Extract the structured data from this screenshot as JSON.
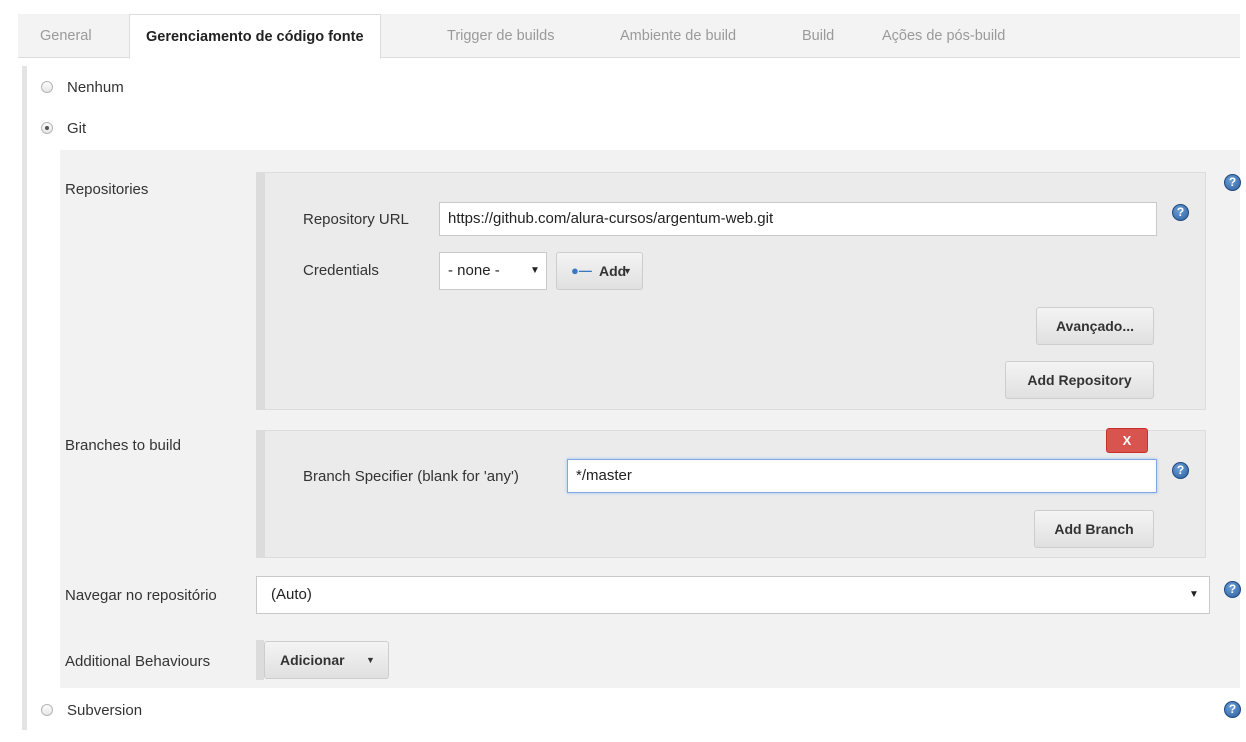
{
  "tabs": [
    {
      "label": "General"
    },
    {
      "label": "Gerenciamento de código fonte"
    },
    {
      "label": "Trigger de builds"
    },
    {
      "label": "Ambiente de build"
    },
    {
      "label": "Build"
    },
    {
      "label": "Ações de pós-build"
    }
  ],
  "scm_options": {
    "none": "Nenhum",
    "git": "Git",
    "subversion": "Subversion"
  },
  "repositories": {
    "section_label": "Repositories",
    "url_label": "Repository URL",
    "url_value": "https://github.com/alura-cursos/argentum-web.git",
    "credentials_label": "Credentials",
    "credentials_value": "- none -",
    "add_credentials_label": "Add",
    "advanced_label": "Avançado...",
    "add_repository_label": "Add Repository"
  },
  "branches": {
    "section_label": "Branches to build",
    "delete_label": "X",
    "specifier_label": "Branch Specifier (blank for 'any')",
    "specifier_value": "*/master",
    "add_branch_label": "Add Branch"
  },
  "browser": {
    "label": "Navegar no repositório",
    "value": "(Auto)"
  },
  "behaviours": {
    "label": "Additional Behaviours",
    "add_label": "Adicionar"
  },
  "help_glyph": "?",
  "colors": {
    "accent_blue": "#2c5e9e",
    "delete_red": "#d9534f",
    "focus_border": "#7fa7e0"
  }
}
